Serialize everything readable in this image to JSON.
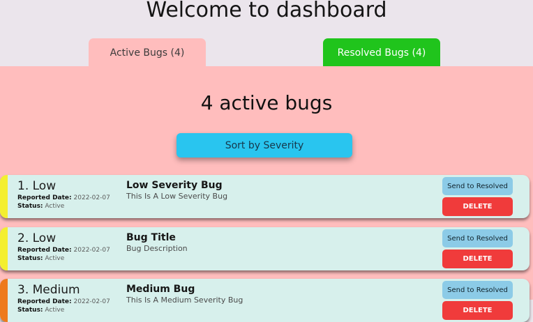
{
  "header": {
    "title": "Welcome to dashboard"
  },
  "tabs": [
    {
      "label": "Active Bugs (4)",
      "color": "#ffbdbd"
    },
    {
      "label": "Resolved Bugs (4)",
      "color": "#20c41c"
    }
  ],
  "active_panel": {
    "title": "4 active bugs",
    "sort_label": "Sort by Severity",
    "bugs": [
      {
        "index_label": "1. Low",
        "date_key": "Reported Date:",
        "date": "2022-02-07",
        "status_key": "Status:",
        "status": "Active",
        "title": "Low Severity Bug",
        "description": "This Is A Low Severity Bug",
        "severity_color": "#f4ef2f",
        "resolve_label": "Send to Resolved",
        "delete_label": "DELETE"
      },
      {
        "index_label": "2. Low",
        "date_key": "Reported Date:",
        "date": "2022-02-07",
        "status_key": "Status:",
        "status": "Active",
        "title": "Bug Title",
        "description": "Bug Description",
        "severity_color": "#f4ef2f",
        "resolve_label": "Send to Resolved",
        "delete_label": "DELETE"
      },
      {
        "index_label": "3. Medium",
        "date_key": "Reported Date:",
        "date": "2022-02-07",
        "status_key": "Status:",
        "status": "Active",
        "title": "Medium Bug",
        "description": "This Is A Medium Severity Bug",
        "severity_color": "#ee7a1c",
        "resolve_label": "Send to Resolved",
        "delete_label": "DELETE"
      }
    ]
  },
  "colors": {
    "background": "#ebe5ec",
    "active_panel": "#ffbdbd",
    "card": "#d7f0ec",
    "sort_button": "#29c5ef",
    "resolve_button": "#8ccbe7",
    "delete_button": "#f03b3b"
  }
}
